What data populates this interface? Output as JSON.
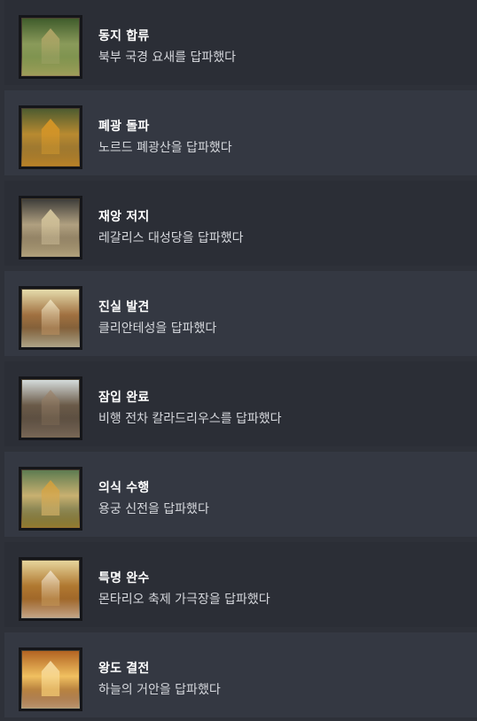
{
  "achievements": [
    {
      "title": "동지 합류",
      "description": "북부 국경 요새를 답파했다",
      "icon": "achievement-thumbnail",
      "palette": [
        "#3d5a2a",
        "#8a9a5a",
        "#c8b070",
        "#6f8a40"
      ]
    },
    {
      "title": "폐광 돌파",
      "description": "노르드 폐광산을 답파했다",
      "icon": "achievement-thumbnail",
      "palette": [
        "#4a5a30",
        "#b88a30",
        "#f0a020",
        "#7a6030"
      ]
    },
    {
      "title": "재앙 저지",
      "description": "레갈리스 대성당을 답파했다",
      "icon": "achievement-thumbnail",
      "palette": [
        "#3a3a38",
        "#b0a080",
        "#f0e0b0",
        "#6a5a40"
      ]
    },
    {
      "title": "진실 발견",
      "description": "클리안테성을 답파했다",
      "icon": "achievement-thumbnail",
      "palette": [
        "#e8e0b0",
        "#a07040",
        "#f8f0d0",
        "#5a4a30"
      ]
    },
    {
      "title": "잠입 완료",
      "description": "비행 전차 칼라드리우스를 답파했다",
      "icon": "achievement-thumbnail",
      "palette": [
        "#d8e0e0",
        "#6a5a48",
        "#a08870",
        "#4a4038"
      ]
    },
    {
      "title": "의식 수행",
      "description": "용궁 신전을 답파했다",
      "icon": "achievement-thumbnail",
      "palette": [
        "#5a7a50",
        "#c8b070",
        "#e0a030",
        "#3a5030"
      ]
    },
    {
      "title": "특명 완수",
      "description": "몬타리오 축제 가극장을 답파했다",
      "icon": "achievement-thumbnail",
      "palette": [
        "#e8d8a0",
        "#b07830",
        "#f8f0e0",
        "#8a5020"
      ]
    },
    {
      "title": "왕도 결전",
      "description": "하늘의 거안을 답파했다",
      "icon": "achievement-thumbnail",
      "palette": [
        "#b06020",
        "#f0c060",
        "#fff0c0",
        "#6a2a10"
      ]
    }
  ]
}
